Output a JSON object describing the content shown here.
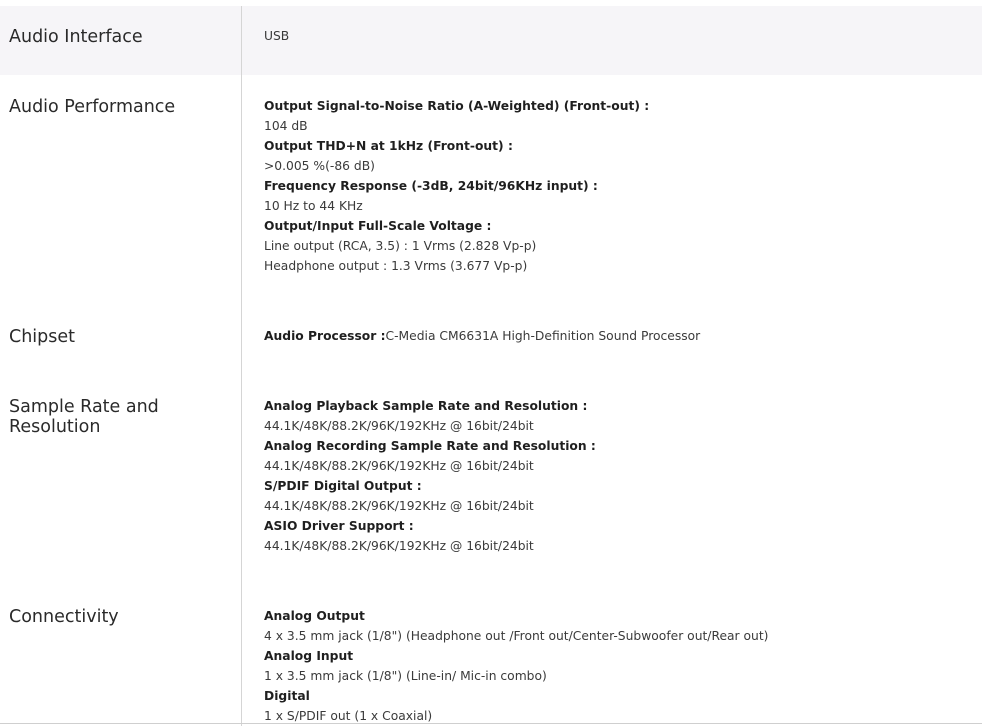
{
  "rows": [
    {
      "label": "Audio Interface",
      "lines": [
        {
          "value": "USB"
        }
      ]
    },
    {
      "label": "Audio Performance",
      "lines": [
        {
          "heading": "Output Signal-to-Noise Ratio (A-Weighted) (Front-out) :"
        },
        {
          "value": "104 dB"
        },
        {
          "heading": "Output THD+N at 1kHz (Front-out) :"
        },
        {
          "value": ">0.005 %(-86 dB)"
        },
        {
          "heading": "Frequency Response (-3dB, 24bit/96KHz input) :"
        },
        {
          "value": "10 Hz to 44 KHz"
        },
        {
          "heading": "Output/Input Full-Scale Voltage :"
        },
        {
          "value": "Line output (RCA, 3.5) : 1 Vrms (2.828 Vp-p)"
        },
        {
          "value": "Headphone output : 1.3 Vrms (3.677 Vp-p)"
        }
      ]
    },
    {
      "label": "Chipset",
      "lines": [
        {
          "heading": "Audio Processor :",
          "value": "C-Media CM6631A High-Definition Sound Processor"
        }
      ]
    },
    {
      "label": "Sample Rate and Resolution",
      "lines": [
        {
          "heading": "Analog Playback Sample Rate and Resolution :"
        },
        {
          "value": "44.1K/48K/88.2K/96K/192KHz @ 16bit/24bit"
        },
        {
          "heading": "Analog Recording Sample Rate and Resolution :"
        },
        {
          "value": "44.1K/48K/88.2K/96K/192KHz @ 16bit/24bit"
        },
        {
          "heading": "S/PDIF Digital Output :"
        },
        {
          "value": "44.1K/48K/88.2K/96K/192KHz @ 16bit/24bit"
        },
        {
          "heading": "ASIO Driver Support :"
        },
        {
          "value": "44.1K/48K/88.2K/96K/192KHz @ 16bit/24bit"
        }
      ]
    },
    {
      "label": "Connectivity",
      "lines": [
        {
          "heading": "Analog Output"
        },
        {
          "value": "4 x 3.5 mm jack (1/8\") (Headphone out /Front out/Center-Subwoofer out/Rear out)"
        },
        {
          "heading": "Analog Input"
        },
        {
          "value": "1 x 3.5 mm jack (1/8\") (Line-in/ Mic-in combo)"
        },
        {
          "heading": "Digital"
        },
        {
          "value": "1 x S/PDIF out (1 x Coaxial)"
        }
      ]
    }
  ]
}
